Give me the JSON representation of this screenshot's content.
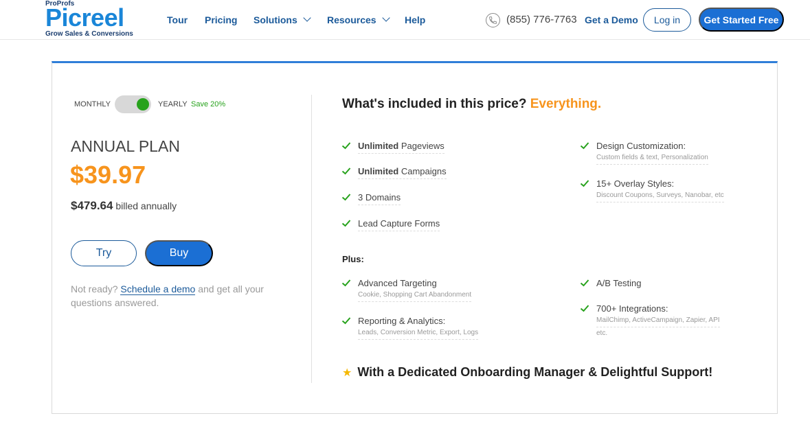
{
  "header": {
    "logo": {
      "top": "ProProfs",
      "name": "Picreel",
      "tagline": "Grow Sales & Conversions"
    },
    "nav": [
      {
        "label": "Tour",
        "dropdown": false
      },
      {
        "label": "Pricing",
        "dropdown": false
      },
      {
        "label": "Solutions",
        "dropdown": true
      },
      {
        "label": "Resources",
        "dropdown": true
      },
      {
        "label": "Help",
        "dropdown": false
      }
    ],
    "phone": "(855) 776-7763",
    "get_demo": "Get a Demo",
    "login": "Log in",
    "get_started": "Get Started Free"
  },
  "plan": {
    "toggle": {
      "monthly_label": "MONTHLY",
      "yearly_label": "YEARLY",
      "save_label": "Save 20%",
      "selected": "yearly"
    },
    "name": "ANNUAL PLAN",
    "price": "$39.97",
    "billed_amount": "$479.64",
    "billed_text": "billed annually",
    "try_label": "Try",
    "buy_label": "Buy",
    "not_ready_prefix": "Not ready?",
    "schedule_link": "Schedule a demo",
    "not_ready_suffix": "and get all your questions answered."
  },
  "included": {
    "title_prefix": "What's included in this price?",
    "title_highlight": "Everything.",
    "features_left": [
      {
        "bold": "Unlimited",
        "text": "Pageviews",
        "sub": ""
      },
      {
        "bold": "Unlimited",
        "text": "Campaigns",
        "sub": ""
      },
      {
        "bold": "",
        "text": "3 Domains",
        "sub": ""
      },
      {
        "bold": "",
        "text": "Lead Capture Forms",
        "sub": ""
      }
    ],
    "features_right": [
      {
        "text": "Design Customization:",
        "sub": "Custom fields & text, Personalization"
      },
      {
        "text": "15+ Overlay Styles:",
        "sub": "Discount Coupons, Surveys, Nanobar, etc"
      }
    ],
    "plus_label": "Plus:",
    "plus_left": [
      {
        "text": "Advanced Targeting",
        "sub": "Cookie, Shopping Cart Abandonment"
      },
      {
        "text": "Reporting & Analytics:",
        "sub": "Leads, Conversion Metric, Export, Logs"
      }
    ],
    "plus_right": [
      {
        "text": "A/B Testing",
        "sub": ""
      },
      {
        "text": "700+ Integrations:",
        "sub_line1": "MailChimp, ActiveCampaign, Zapier, API",
        "sub_line2": "etc."
      }
    ],
    "support": "With a Dedicated Onboarding Manager & Delightful Support!"
  },
  "colors": {
    "brand_blue": "#1b6fd4",
    "accent_orange": "#f7941d",
    "check_green": "#27a21c",
    "star_yellow": "#f5b800"
  }
}
